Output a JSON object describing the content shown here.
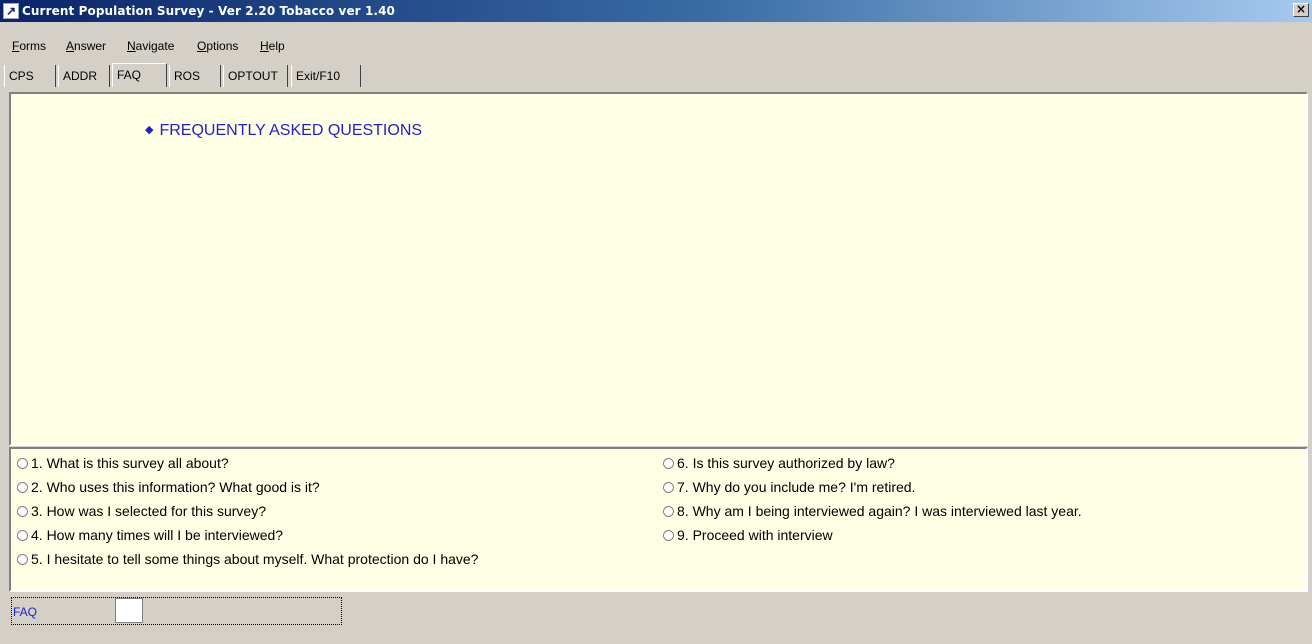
{
  "window": {
    "title": "Current Population Survey - Ver 2.20 Tobacco ver 1.40",
    "close_glyph": "×"
  },
  "menu": [
    {
      "label": "Forms",
      "mnemonic": "F",
      "rest": "orms"
    },
    {
      "label": "Answer",
      "mnemonic": "A",
      "rest": "nswer"
    },
    {
      "label": "Navigate",
      "mnemonic": "N",
      "rest": "avigate"
    },
    {
      "label": "Options",
      "mnemonic": "O",
      "rest": "ptions"
    },
    {
      "label": "Help",
      "mnemonic": "H",
      "rest": "elp"
    }
  ],
  "tabs": [
    {
      "label": "CPS",
      "active": false
    },
    {
      "label": "ADDR",
      "active": false
    },
    {
      "label": "FAQ",
      "active": true
    },
    {
      "label": "ROS",
      "active": false
    },
    {
      "label": "OPTOUT",
      "active": false
    },
    {
      "label": "Exit/F10",
      "active": false
    }
  ],
  "content": {
    "bullet": "◆",
    "heading": "FREQUENTLY ASKED QUESTIONS"
  },
  "options": [
    "1. What is this survey all about?",
    "2. Who uses this information? What good is it?",
    "3. How was I selected for this survey?",
    "4. How many times will I be interviewed?",
    "5. I hesitate to tell some things about myself. What protection do I have?",
    "6. Is this survey authorized by law?",
    "7. Why do you include me? I'm retired.",
    "8. Why am I being interviewed again? I was interviewed last year.",
    "9. Proceed with interview"
  ],
  "status": {
    "field_label": "FAQ",
    "field_value": ""
  },
  "colors": {
    "panel_background": "#ffffe6",
    "heading_color": "#1f1fd0",
    "title_gradient_start": "#0a246a"
  }
}
